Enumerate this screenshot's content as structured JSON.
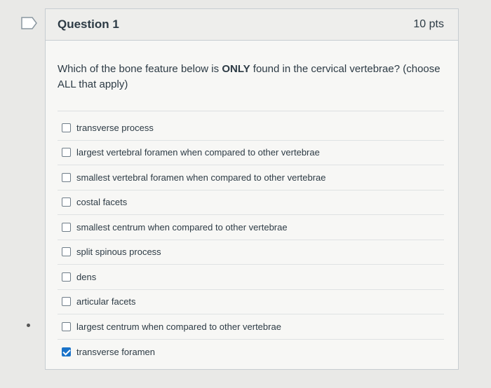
{
  "question": {
    "title": "Question 1",
    "points": "10 pts",
    "text_before": "Which of the bone feature below is ",
    "text_emphasis": "ONLY",
    "text_after": " found in the cervical vertebrae? (choose ALL that apply)"
  },
  "answers": [
    {
      "label": "transverse process",
      "checked": false
    },
    {
      "label": "largest vertebral foramen when compared to other vertebrae",
      "checked": false
    },
    {
      "label": "smallest vertebral foramen when compared to other vertebrae",
      "checked": false
    },
    {
      "label": "costal facets",
      "checked": false
    },
    {
      "label": "smallest centrum when compared to other vertebrae",
      "checked": false
    },
    {
      "label": "split spinous process",
      "checked": false
    },
    {
      "label": "dens",
      "checked": false
    },
    {
      "label": "articular facets",
      "checked": false
    },
    {
      "label": "largest centrum when compared to other vertebrae",
      "checked": false
    },
    {
      "label": "transverse foramen",
      "checked": true
    }
  ],
  "colors": {
    "checkbox_checked": "#1a73c9",
    "text": "#2d3b45"
  }
}
